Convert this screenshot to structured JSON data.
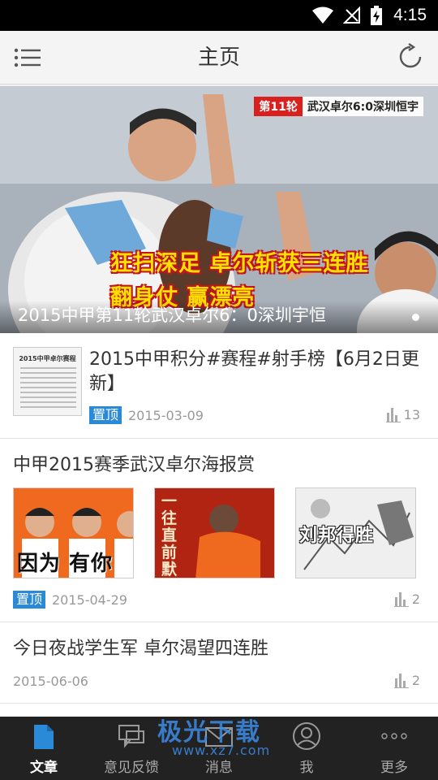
{
  "status_bar": {
    "time": "4:15"
  },
  "app_bar": {
    "title": "主页",
    "menu_icon": "list-menu-icon",
    "refresh_icon": "refresh-icon"
  },
  "banner": {
    "tag_round": "第11轮",
    "tag_text": "武汉卓尔6:0深圳恒宇",
    "headline_1": "狂扫深足 卓尔斩获三连胜",
    "headline_2": "翻身仗 赢漂亮",
    "caption": "2015中甲第11轮武汉卓尔6：0深圳宇恒"
  },
  "feed": {
    "items": [
      {
        "title": "2015中甲积分#赛程#射手榜【6月2日更新】",
        "thumb_text": "2015中甲卓尔赛程",
        "pin": "置顶",
        "date": "2015-03-09",
        "count": "13"
      },
      {
        "title": "中甲2015赛季武汉卓尔海报赏",
        "thumbs": [
          "因为 有你",
          "一往直前 默",
          "刘邦得胜"
        ],
        "pin": "置顶",
        "date": "2015-04-29",
        "count": "2"
      },
      {
        "title": "今日夜战学生军 卓尔渴望四连胜",
        "date": "2015-06-06",
        "count": "2"
      }
    ]
  },
  "tabs": [
    {
      "label": "文章",
      "icon": "article-icon",
      "active": true
    },
    {
      "label": "意见反馈",
      "icon": "feedback-icon",
      "active": false
    },
    {
      "label": "消息",
      "icon": "message-icon",
      "active": false
    },
    {
      "label": "我",
      "icon": "profile-icon",
      "active": false
    },
    {
      "label": "更多",
      "icon": "more-icon",
      "active": false
    }
  ],
  "watermark": {
    "line1": "极光下载",
    "line2": "www.xz7.com"
  },
  "colors": {
    "accent": "#2b8ad8",
    "tab_bar": "#222222",
    "status_bar": "#000000"
  }
}
